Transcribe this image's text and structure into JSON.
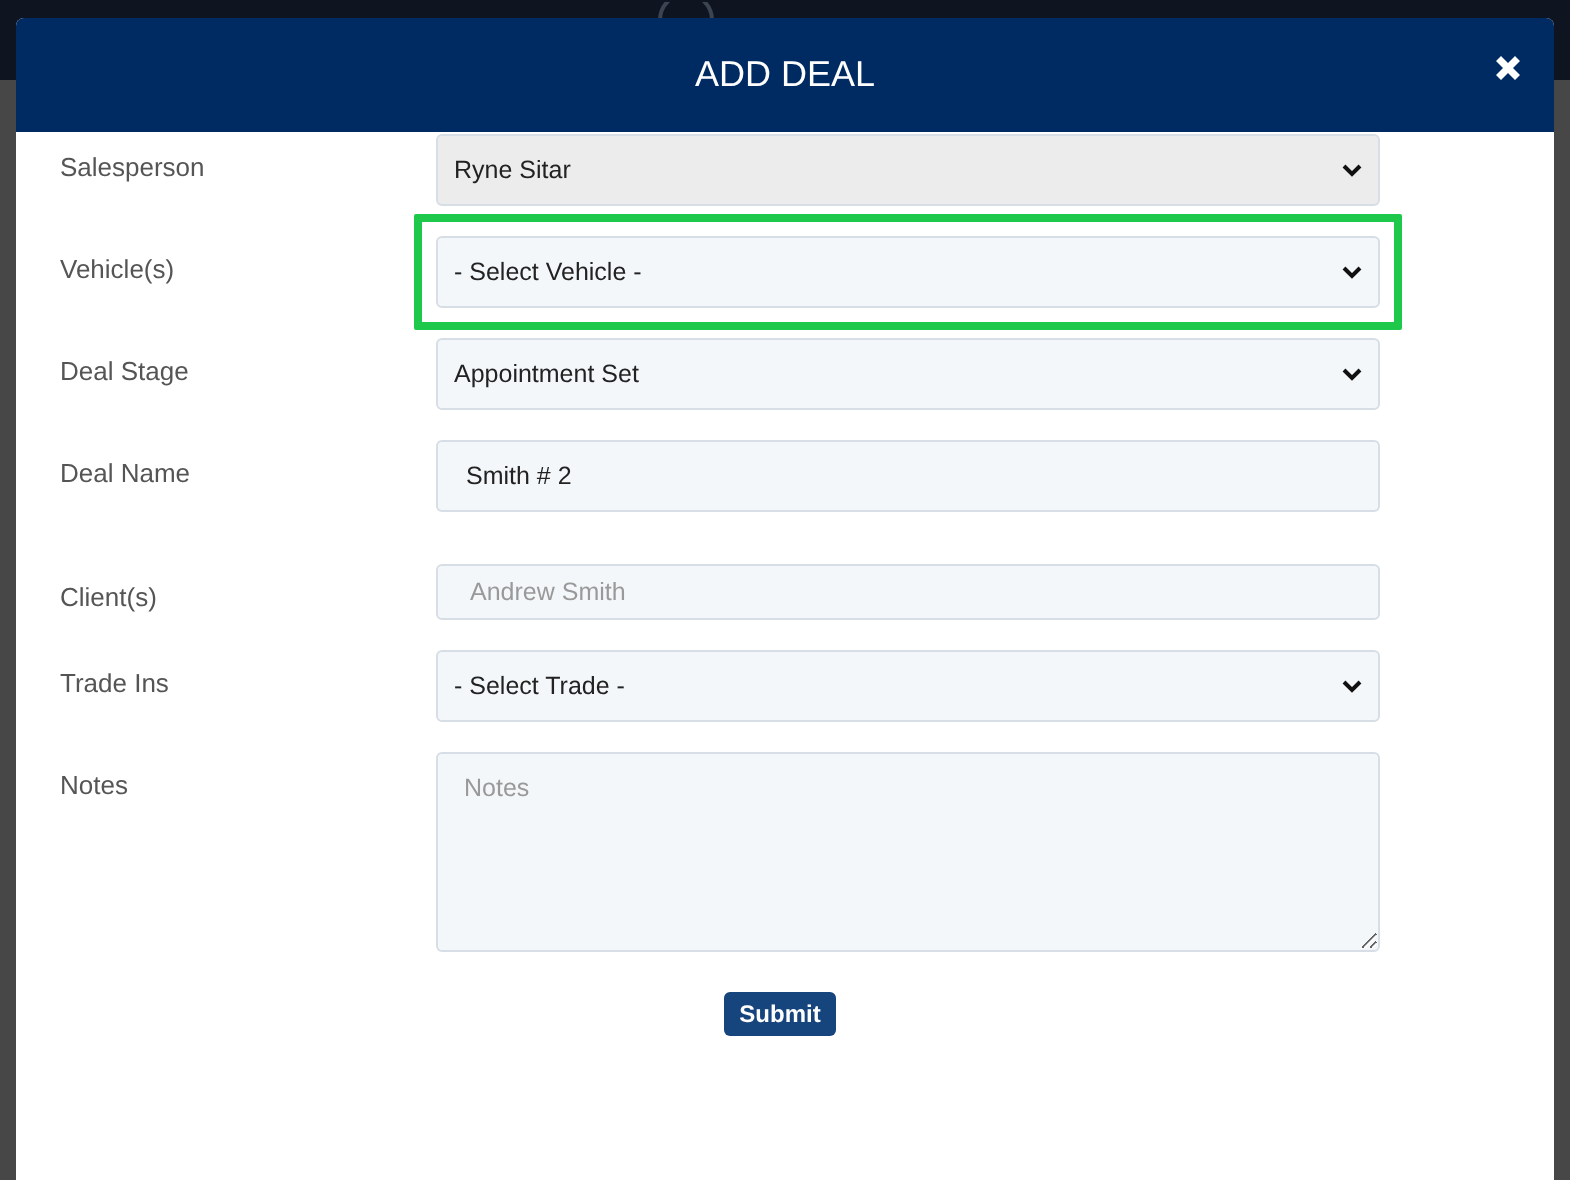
{
  "modal": {
    "title": "ADD DEAL"
  },
  "fields": [
    {
      "label": "Salesperson",
      "kind": "select",
      "value": "Ryne Sitar",
      "disabled": true,
      "highlighted": false
    },
    {
      "label": "Vehicle(s)",
      "kind": "select",
      "value": "- Select Vehicle -",
      "disabled": false,
      "highlighted": true
    },
    {
      "label": "Deal Stage",
      "kind": "select",
      "value": "Appointment Set",
      "disabled": false,
      "highlighted": false
    },
    {
      "label": "Deal Name",
      "kind": "input",
      "value": "Smith # 2",
      "disabled": false,
      "highlighted": false
    },
    {
      "label": "Client(s)",
      "kind": "tags",
      "placeholder": "Andrew Smith",
      "disabled": false,
      "highlighted": false
    },
    {
      "label": "Trade Ins",
      "kind": "select",
      "value": "- Select Trade -",
      "disabled": false,
      "highlighted": false
    },
    {
      "label": "Notes",
      "kind": "textarea",
      "placeholder": "Notes",
      "disabled": false,
      "highlighted": false
    }
  ],
  "submit": "Submit"
}
